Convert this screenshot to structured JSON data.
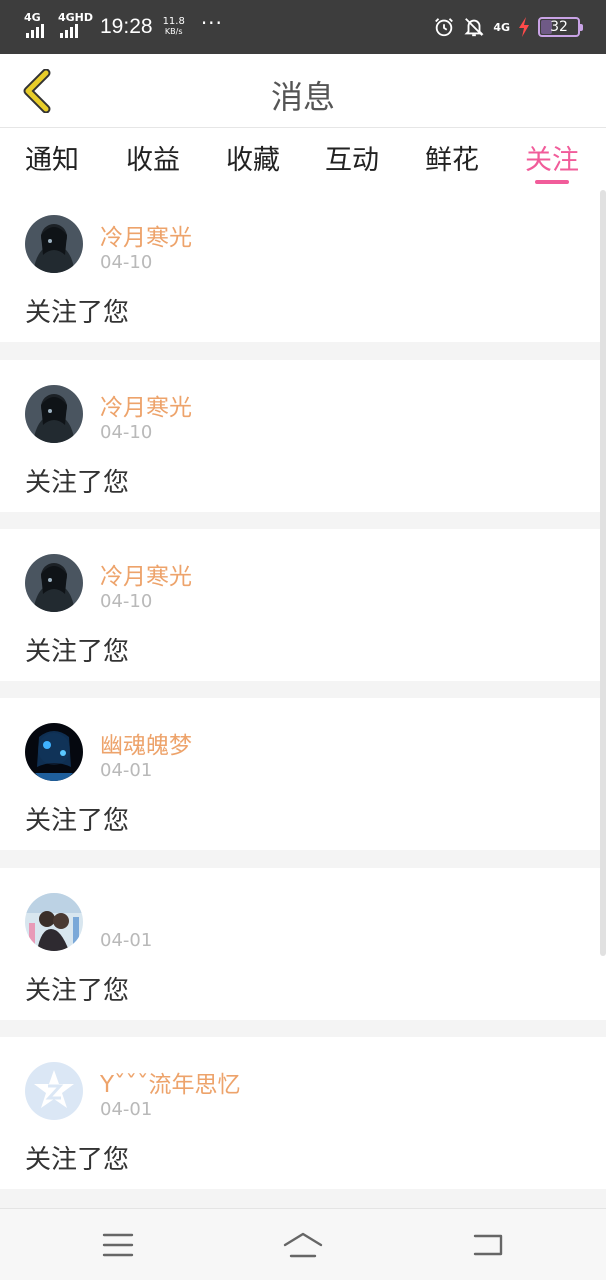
{
  "status_bar": {
    "signal1_label": "4G",
    "signal2_label": "4GHD",
    "time": "19:28",
    "net_speed_value": "11.8",
    "net_speed_unit": "KB/s",
    "more": "···",
    "net_small_label": "4G",
    "battery_level": "32",
    "icons": [
      "alarm-icon",
      "notification-off-icon",
      "charging-icon"
    ]
  },
  "header": {
    "title": "消息",
    "back_icon": "chevron-left-icon",
    "accent_color": "#e8cd2a"
  },
  "tabs": {
    "items": [
      {
        "label": "通知"
      },
      {
        "label": "收益"
      },
      {
        "label": "收藏"
      },
      {
        "label": "互动"
      },
      {
        "label": "鲜花"
      },
      {
        "label": "关注"
      }
    ],
    "active": "关注",
    "active_color": "#f15c9a"
  },
  "notifications": [
    {
      "username": "冷月寒光",
      "date": "04-10",
      "text": "关注了您",
      "avatar": "dark-anime-avatar"
    },
    {
      "username": "冷月寒光",
      "date": "04-10",
      "text": "关注了您",
      "avatar": "dark-anime-avatar"
    },
    {
      "username": "冷月寒光",
      "date": "04-10",
      "text": "关注了您",
      "avatar": "dark-anime-avatar"
    },
    {
      "username": "幽魂魄梦",
      "date": "04-01",
      "text": "关注了您",
      "avatar": "blue-glow-avatar"
    },
    {
      "username": "",
      "date": "04-01",
      "text": "关注了您",
      "avatar": "photo-avatar"
    },
    {
      "username": "Yˇˇˇ流年思忆",
      "date": "04-01",
      "text": "关注了您",
      "avatar": "default-qq-avatar"
    }
  ],
  "colors": {
    "username": "#eda36b",
    "date": "#b9b9b9",
    "body_text": "#333333",
    "background": "#f4f4f4"
  },
  "navbar": {
    "icons": [
      "menu-icon",
      "home-icon",
      "back-icon"
    ]
  }
}
